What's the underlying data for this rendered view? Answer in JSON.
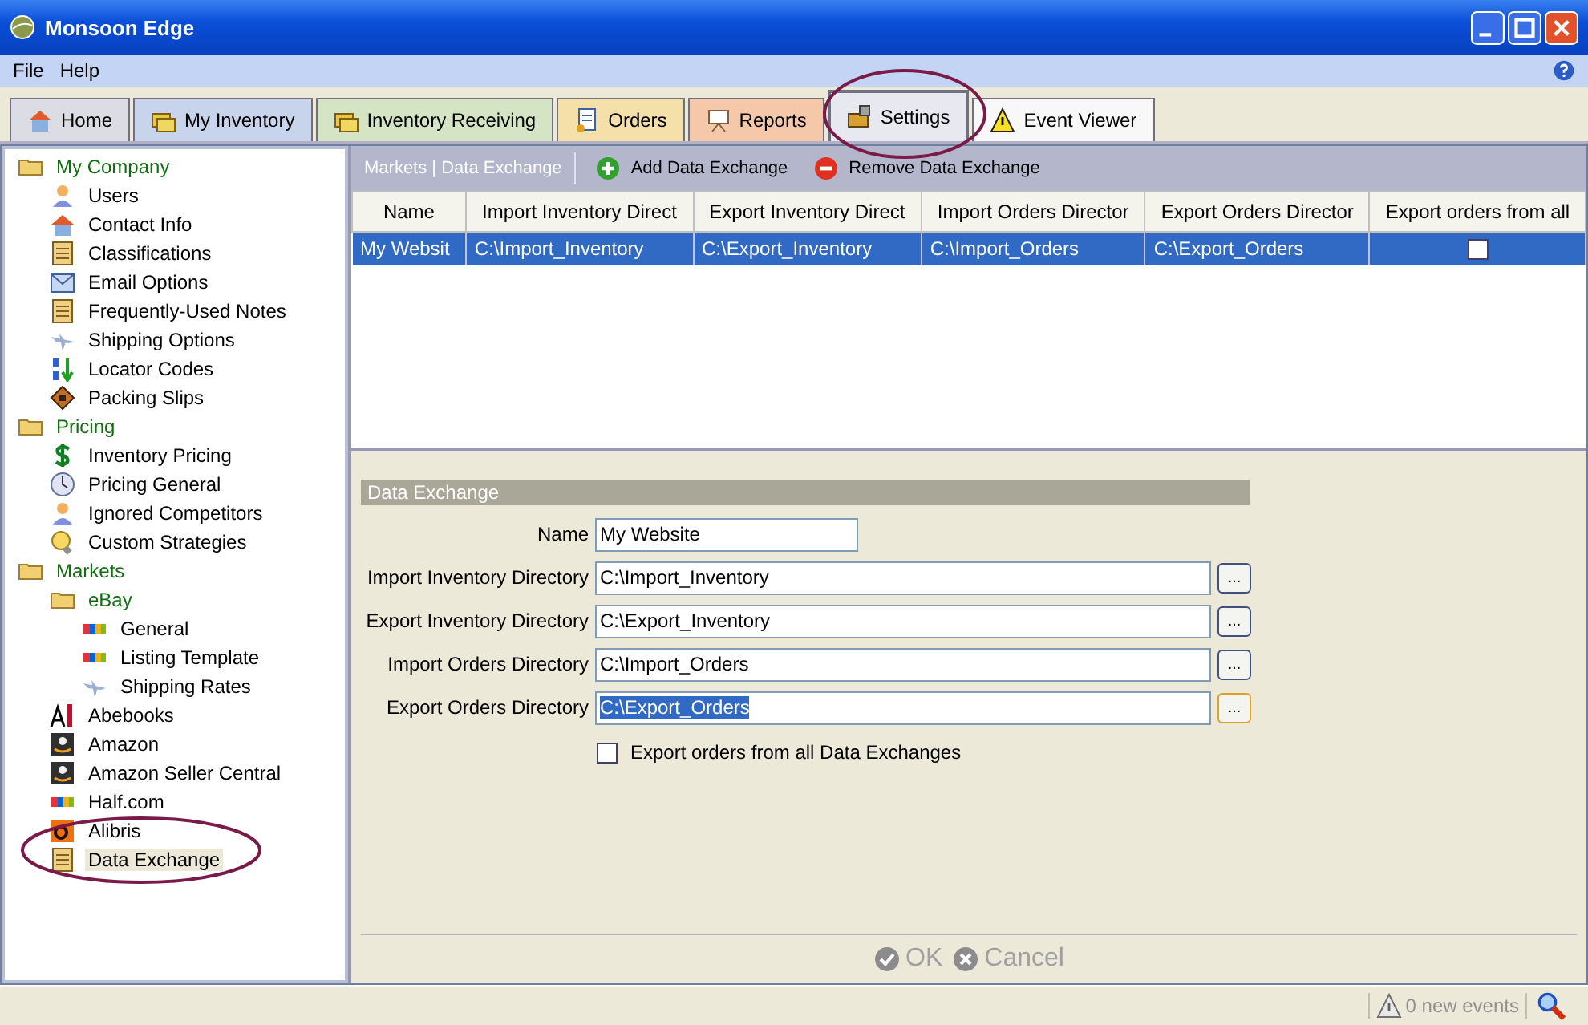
{
  "window": {
    "title": "Monsoon Edge"
  },
  "menu": [
    "File",
    "Help"
  ],
  "tabs": [
    {
      "label": "Home",
      "kind": "house",
      "color": "#dcdce4",
      "selected": false
    },
    {
      "label": "My Inventory",
      "kind": "folders",
      "color": "#c8d4ec",
      "selected": false
    },
    {
      "label": "Inventory Receiving",
      "kind": "receive",
      "color": "#d4e4c4",
      "selected": false
    },
    {
      "label": "Orders",
      "kind": "orders",
      "color": "#f4e0a8",
      "selected": false
    },
    {
      "label": "Reports",
      "kind": "reports",
      "color": "#f4c8a8",
      "selected": false
    },
    {
      "label": "Settings",
      "kind": "settings",
      "color": "#e8e8f0",
      "selected": true
    },
    {
      "label": "Event Viewer",
      "kind": "warning",
      "color": "#f8f8f8",
      "selected": false
    }
  ],
  "sidebar": {
    "tree": [
      {
        "label": "My Company",
        "kind": "folder",
        "selected": false,
        "children": [
          {
            "label": "Users",
            "kind": "user",
            "selected": false
          },
          {
            "label": "Contact Info",
            "kind": "house",
            "selected": false
          },
          {
            "label": "Classifications",
            "kind": "note",
            "selected": false
          },
          {
            "label": "Email Options",
            "kind": "mail",
            "selected": false
          },
          {
            "label": "Frequently-Used Notes",
            "kind": "note",
            "selected": false
          },
          {
            "label": "Shipping Options",
            "kind": "plane",
            "selected": false
          },
          {
            "label": "Locator Codes",
            "kind": "sort",
            "selected": false
          },
          {
            "label": "Packing Slips",
            "kind": "book",
            "selected": false
          }
        ]
      },
      {
        "label": "Pricing",
        "kind": "folder",
        "selected": false,
        "children": [
          {
            "label": "Inventory Pricing",
            "kind": "dollar",
            "selected": false
          },
          {
            "label": "Pricing General",
            "kind": "clock",
            "selected": false
          },
          {
            "label": "Ignored Competitors",
            "kind": "user",
            "selected": false
          },
          {
            "label": "Custom Strategies",
            "kind": "bulb",
            "selected": false
          }
        ]
      },
      {
        "label": "Markets",
        "kind": "folder",
        "selected": false,
        "children": [
          {
            "label": "eBay",
            "kind": "folder",
            "selected": false,
            "children": [
              {
                "label": "General",
                "kind": "ebay",
                "selected": false
              },
              {
                "label": "Listing Template",
                "kind": "ebay",
                "selected": false
              },
              {
                "label": "Shipping Rates",
                "kind": "plane",
                "selected": false
              }
            ]
          },
          {
            "label": "Abebooks",
            "kind": "abe",
            "selected": false
          },
          {
            "label": "Amazon",
            "kind": "amazon",
            "selected": false
          },
          {
            "label": "Amazon Seller Central",
            "kind": "amazon",
            "selected": false
          },
          {
            "label": "Half.com",
            "kind": "ebay",
            "selected": false
          },
          {
            "label": "Alibris",
            "kind": "alibris",
            "selected": false
          },
          {
            "label": "Data Exchange",
            "kind": "note",
            "selected": true
          }
        ]
      }
    ]
  },
  "toolbar": {
    "breadcrumb": "Markets | Data Exchange",
    "add": "Add Data Exchange",
    "remove": "Remove Data Exchange"
  },
  "table": {
    "columns": [
      "Name",
      "Import Inventory Direct",
      "Export Inventory Direct",
      "Import Orders Director",
      "Export Orders Director",
      "Export orders from all"
    ],
    "rows": [
      {
        "cells": [
          "My Websit",
          "C:\\Import_Inventory",
          "C:\\Export_Inventory",
          "C:\\Import_Orders",
          "C:\\Export_Orders"
        ],
        "export_all": false,
        "selected": true
      }
    ]
  },
  "form": {
    "title": "Data Exchange",
    "fields": [
      {
        "label": "Name",
        "value": "My Website",
        "kind": "short",
        "highlighted": false
      },
      {
        "label": "Import Inventory  Directory",
        "value": "C:\\Import_Inventory",
        "kind": "path",
        "highlighted": false
      },
      {
        "label": "Export Inventory Directory",
        "value": "C:\\Export_Inventory",
        "kind": "path",
        "highlighted": false
      },
      {
        "label": "Import Orders Directory",
        "value": "C:\\Import_Orders",
        "kind": "path",
        "highlighted": false
      },
      {
        "label": "Export Orders Directory",
        "value": "C:\\Export_Orders",
        "kind": "path",
        "highlighted": true
      }
    ],
    "browse_label": "...",
    "checkbox": {
      "label": "Export orders from all Data Exchanges",
      "checked": false
    }
  },
  "actions": [
    {
      "label": "OK",
      "kind": "ok",
      "disabled": true
    },
    {
      "label": "Cancel",
      "kind": "cancel",
      "disabled": true
    }
  ],
  "status_bar": {
    "events": "0 new events"
  }
}
